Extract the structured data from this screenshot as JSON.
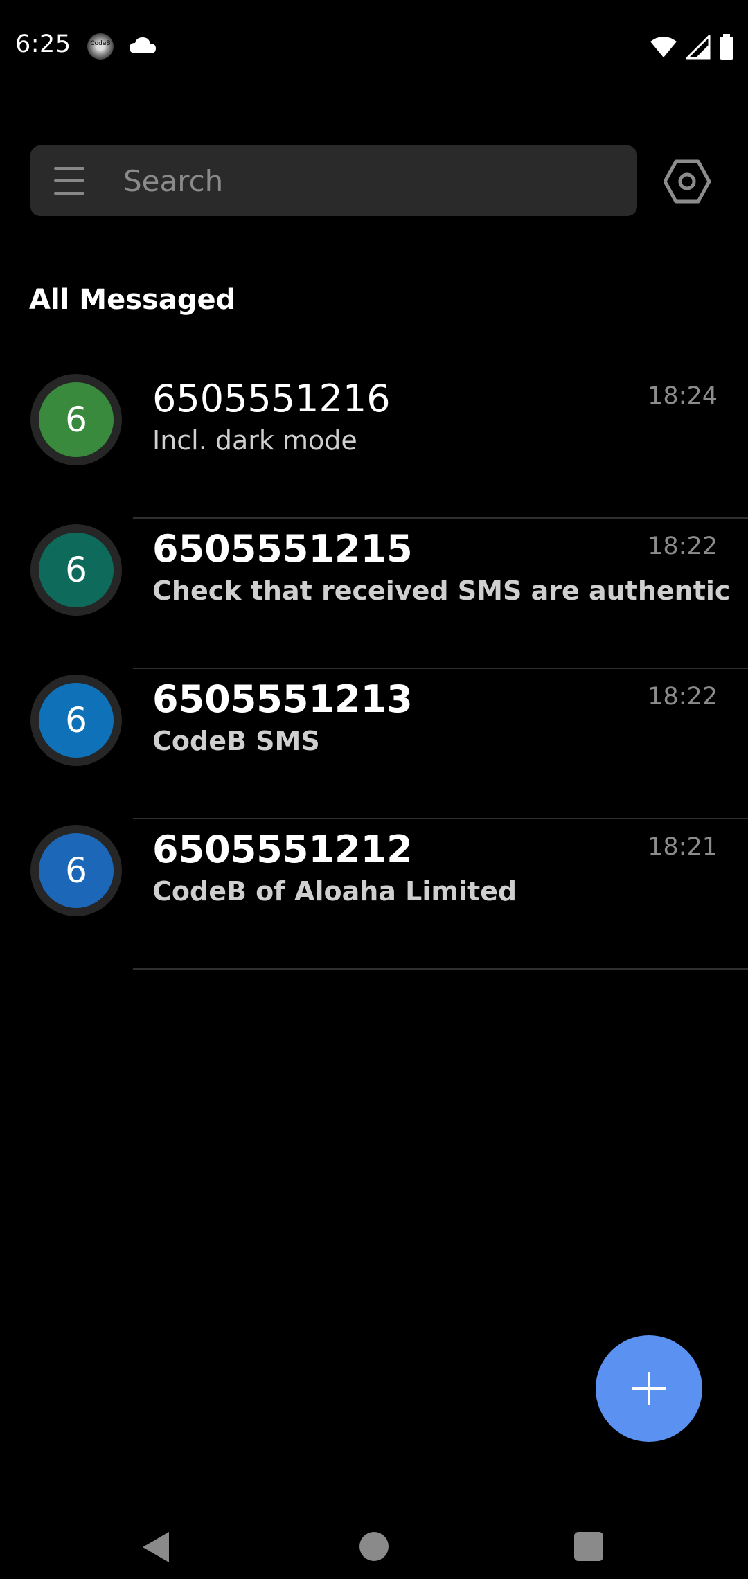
{
  "status_bar": {
    "time": "6:25",
    "app_logo_text": "CodeB",
    "icons": [
      "app-logo-icon",
      "cloud-icon",
      "wifi-icon",
      "signal-icon",
      "battery-icon"
    ]
  },
  "search": {
    "placeholder": "Search",
    "value": ""
  },
  "section_title": "All Messaged",
  "conversations": [
    {
      "avatar_letter": "6",
      "avatar_color": "#3a8a3e",
      "name": "6505551216",
      "preview": "Incl. dark mode",
      "time": "18:24",
      "unread": false
    },
    {
      "avatar_letter": "6",
      "avatar_color": "#0e6b5b",
      "name": "6505551215",
      "preview": "Check that received SMS are authentic",
      "time": "18:22",
      "unread": true
    },
    {
      "avatar_letter": "6",
      "avatar_color": "#0f72b8",
      "name": "6505551213",
      "preview": "CodeB SMS",
      "time": "18:22",
      "unread": true
    },
    {
      "avatar_letter": "6",
      "avatar_color": "#1d67b8",
      "name": "6505551212",
      "preview": "CodeB of Aloaha Limited",
      "time": "18:21",
      "unread": true
    }
  ],
  "colors": {
    "background": "#000000",
    "search_bg": "#2a2a2a",
    "fab": "#5b91f0",
    "divider": "#2e2e2e"
  },
  "fab": {
    "icon": "plus-icon"
  },
  "nav": {
    "icons": [
      "back-icon",
      "home-icon",
      "recents-icon"
    ]
  }
}
